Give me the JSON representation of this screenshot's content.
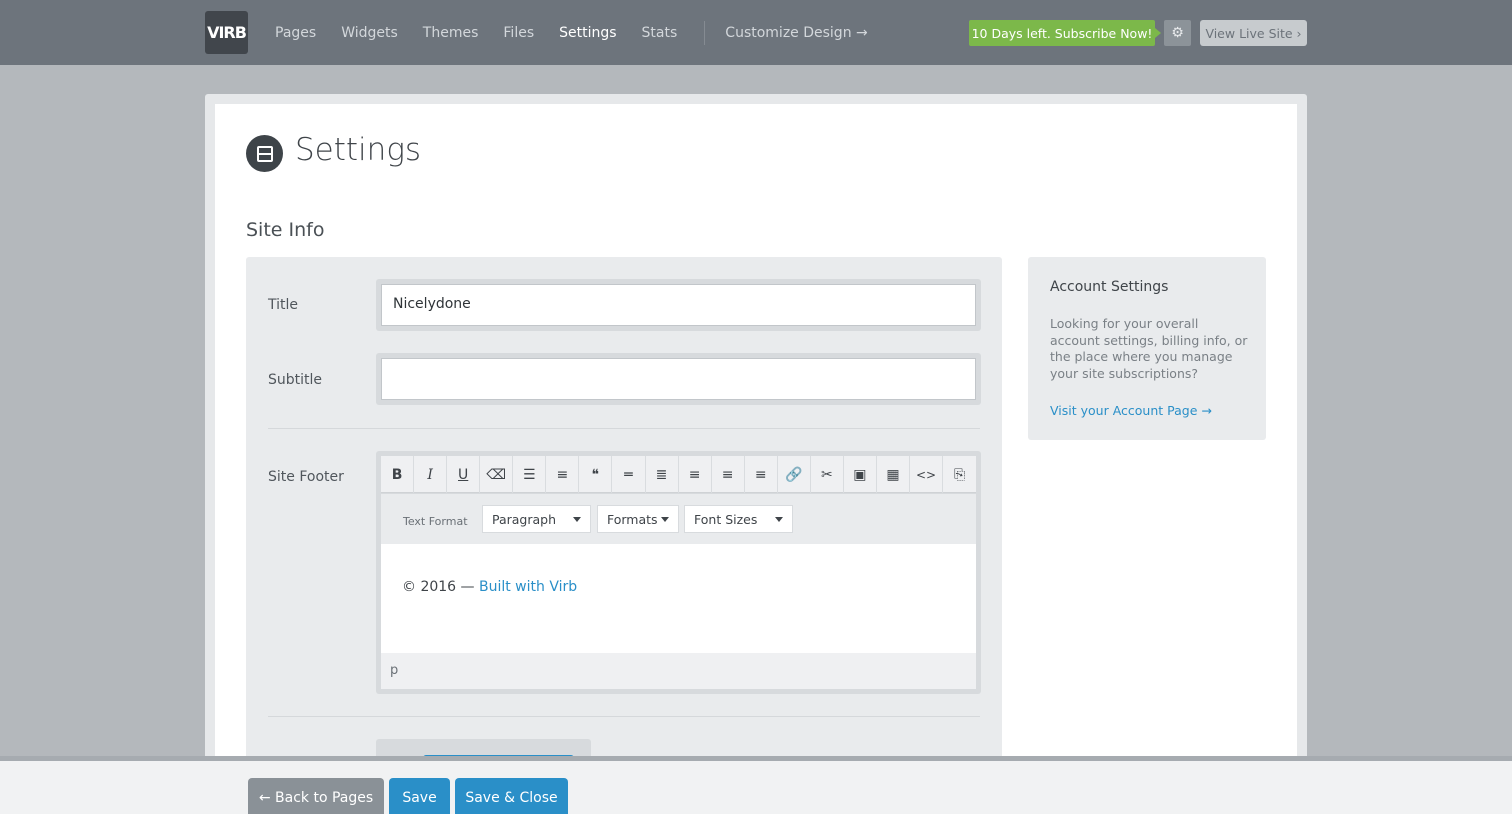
{
  "topbar": {
    "logo_text": "VIRB",
    "nav": [
      "Pages",
      "Widgets",
      "Themes",
      "Files",
      "Settings",
      "Stats"
    ],
    "active_nav": "Settings",
    "customize": "Customize Design →",
    "subscribe": "10 Days left. Subscribe Now!",
    "gear_icon": "gear-icon",
    "view_live": "View Live Site ›"
  },
  "page": {
    "title": "Settings",
    "section": "Site Info"
  },
  "form": {
    "title_label": "Title",
    "title_value": "Nicelydone",
    "subtitle_label": "Subtitle",
    "subtitle_value": "",
    "footer_label": "Site Footer"
  },
  "editor": {
    "toolbar_icons": [
      "B",
      "I",
      "U",
      "⌫",
      "☰",
      "≡",
      "❝",
      "═",
      "≣",
      "≡",
      "≡",
      "≡",
      "🔗",
      "✂",
      "▣",
      "▦",
      "<>",
      "⎘"
    ],
    "text_format_label": "Text Format",
    "paragraph": "Paragraph",
    "formats": "Formats",
    "font_sizes": "Font Sizes",
    "content_prefix": "© 2016 — ",
    "content_link": "Built with Virb",
    "path": "p"
  },
  "account": {
    "title": "Account Settings",
    "description": "Looking for your overall account settings, billing info, or the place where you manage your site subscriptions?",
    "link": "Visit your Account Page →"
  },
  "actions": {
    "back": "← Back to Pages",
    "save": "Save",
    "save_close": "Save & Close"
  },
  "colors": {
    "accent": "#2a8fc8",
    "subscribe": "#7cb84a",
    "topbar": "#6d747c"
  }
}
